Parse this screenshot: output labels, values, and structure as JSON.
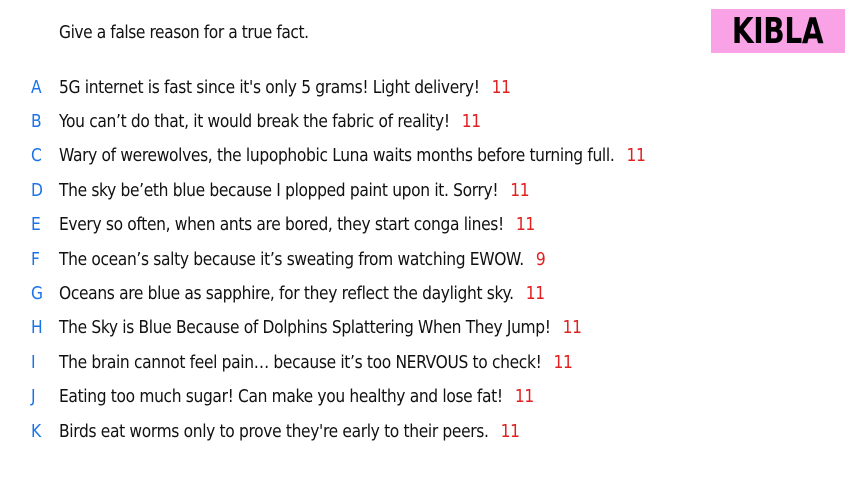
{
  "prompt": "Give a false reason for a true fact.",
  "badge": {
    "label": "KIBLA",
    "color": "#f9a3e6"
  },
  "colors": {
    "letter": "#1a73e8",
    "score": "#e02020"
  },
  "entries": [
    {
      "letter": "A",
      "text": "5G internet is fast since it's only 5 grams! Light delivery!",
      "score": "11"
    },
    {
      "letter": "B",
      "text": "You can’t do that, it would break the fabric of reality!",
      "score": "11"
    },
    {
      "letter": "C",
      "text": "Wary of werewolves, the lupophobic Luna waits months before turning full.",
      "score": "11"
    },
    {
      "letter": "D",
      "text": "The sky be’eth blue because I plopped paint upon it. Sorry!",
      "score": "11"
    },
    {
      "letter": "E",
      "text": "Every so often, when ants are bored, they start conga lines!",
      "score": "11"
    },
    {
      "letter": "F",
      "text": "The ocean’s salty because it’s sweating from watching EWOW.",
      "score": "9"
    },
    {
      "letter": "G",
      "text": "Oceans are blue as sapphire, for they reflect the daylight sky.",
      "score": "11"
    },
    {
      "letter": "H",
      "text": "The Sky is Blue Because of Dolphins Splattering When They Jump!",
      "score": "11"
    },
    {
      "letter": "I",
      "text": "The brain cannot feel pain… because it’s too NERVOUS to check!",
      "score": "11"
    },
    {
      "letter": "J",
      "text": "Eating too much sugar! Can make you healthy and lose fat!",
      "score": "11"
    },
    {
      "letter": "K",
      "text": "Birds eat worms only to prove they're early to their peers.",
      "score": "11"
    }
  ]
}
